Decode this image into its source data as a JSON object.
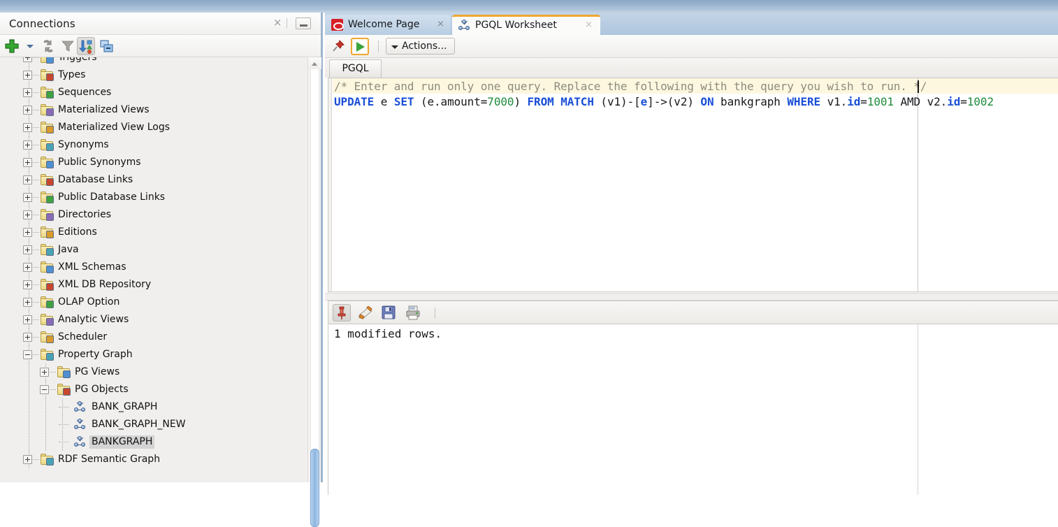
{
  "left_panel": {
    "title": "Connections",
    "close_label": "×",
    "toolbar": [
      {
        "name": "new-connection-icon",
        "label": "New Connection"
      },
      {
        "name": "new-connection-dropdown-icon",
        "label": "New Connection Options"
      },
      {
        "name": "refresh-icon",
        "label": "Refresh"
      },
      {
        "name": "filter-icon",
        "label": "Filter"
      },
      {
        "name": "sort-icon",
        "label": "Sort"
      },
      {
        "name": "collapse-all-icon",
        "label": "Collapse All"
      }
    ],
    "tree": [
      {
        "label": "Triggers",
        "level": 1,
        "state": "plus",
        "icon": "folder-triggers-icon"
      },
      {
        "label": "Types",
        "level": 1,
        "state": "plus",
        "icon": "folder-types-icon"
      },
      {
        "label": "Sequences",
        "level": 1,
        "state": "plus",
        "icon": "folder-sequences-icon"
      },
      {
        "label": "Materialized Views",
        "level": 1,
        "state": "plus",
        "icon": "folder-materialized-views-icon"
      },
      {
        "label": "Materialized View Logs",
        "level": 1,
        "state": "plus",
        "icon": "folder-materialized-view-logs-icon"
      },
      {
        "label": "Synonyms",
        "level": 1,
        "state": "plus",
        "icon": "folder-synonyms-icon"
      },
      {
        "label": "Public Synonyms",
        "level": 1,
        "state": "plus",
        "icon": "folder-public-synonyms-icon"
      },
      {
        "label": "Database Links",
        "level": 1,
        "state": "plus",
        "icon": "folder-database-links-icon"
      },
      {
        "label": "Public Database Links",
        "level": 1,
        "state": "plus",
        "icon": "folder-public-database-links-icon"
      },
      {
        "label": "Directories",
        "level": 1,
        "state": "plus",
        "icon": "folder-directories-icon"
      },
      {
        "label": "Editions",
        "level": 1,
        "state": "plus",
        "icon": "folder-editions-icon"
      },
      {
        "label": "Java",
        "level": 1,
        "state": "plus",
        "icon": "folder-java-icon"
      },
      {
        "label": "XML Schemas",
        "level": 1,
        "state": "plus",
        "icon": "folder-xml-schemas-icon"
      },
      {
        "label": "XML DB Repository",
        "level": 1,
        "state": "plus",
        "icon": "folder-xml-db-repository-icon"
      },
      {
        "label": "OLAP Option",
        "level": 1,
        "state": "plus",
        "icon": "folder-olap-option-icon"
      },
      {
        "label": "Analytic Views",
        "level": 1,
        "state": "plus",
        "icon": "folder-analytic-views-icon"
      },
      {
        "label": "Scheduler",
        "level": 1,
        "state": "plus",
        "icon": "folder-scheduler-icon"
      },
      {
        "label": "Property Graph",
        "level": 1,
        "state": "minus",
        "icon": "folder-property-graph-icon"
      },
      {
        "label": "PG Views",
        "level": 2,
        "state": "plus",
        "icon": "folder-pg-views-icon"
      },
      {
        "label": "PG Objects",
        "level": 2,
        "state": "minus",
        "icon": "folder-pg-objects-icon"
      },
      {
        "label": "BANK_GRAPH",
        "level": 3,
        "state": "leaf",
        "icon": "graph-icon"
      },
      {
        "label": "BANK_GRAPH_NEW",
        "level": 3,
        "state": "leaf",
        "icon": "graph-icon"
      },
      {
        "label": "BANKGRAPH",
        "level": 3,
        "state": "leaf",
        "icon": "graph-icon",
        "selected": true
      },
      {
        "label": "RDF Semantic Graph",
        "level": 1,
        "state": "plus",
        "icon": "folder-rdf-semantic-graph-icon"
      }
    ]
  },
  "editor_area": {
    "tabs": [
      {
        "label": "Welcome Page",
        "icon": "oracle-logo-icon",
        "active": false,
        "close": "×"
      },
      {
        "label": "PGQL Worksheet",
        "icon": "graph-icon",
        "active": true,
        "close": "×"
      }
    ],
    "toolbar": {
      "pin_label": "Pin",
      "run_label": "Run Query",
      "actions_label": "Actions..."
    },
    "sub_tab": "PGQL",
    "code": {
      "comment": "/* Enter and run only one query. Replace the following with the query you wish to run. */",
      "statement_tokens": [
        {
          "t": "UPDATE",
          "k": "kw"
        },
        {
          "t": " e ",
          "k": "plain"
        },
        {
          "t": "SET",
          "k": "kw"
        },
        {
          "t": " (e.amount=",
          "k": "plain"
        },
        {
          "t": "7000",
          "k": "num"
        },
        {
          "t": ") ",
          "k": "plain"
        },
        {
          "t": "FROM",
          "k": "kw"
        },
        {
          "t": " ",
          "k": "plain"
        },
        {
          "t": "MATCH",
          "k": "kw"
        },
        {
          "t": " (v1)-[",
          "k": "plain"
        },
        {
          "t": "e",
          "k": "kw2"
        },
        {
          "t": "]->(v2) ",
          "k": "plain"
        },
        {
          "t": "ON",
          "k": "kw"
        },
        {
          "t": " bankgraph ",
          "k": "plain"
        },
        {
          "t": "WHERE",
          "k": "kw"
        },
        {
          "t": " v1.",
          "k": "plain"
        },
        {
          "t": "id",
          "k": "kw2"
        },
        {
          "t": "=",
          "k": "plain"
        },
        {
          "t": "1001",
          "k": "num"
        },
        {
          "t": " AMD v2.",
          "k": "plain"
        },
        {
          "t": "id",
          "k": "kw2"
        },
        {
          "t": "=",
          "k": "plain"
        },
        {
          "t": "1002",
          "k": "num"
        }
      ]
    }
  },
  "results_panel": {
    "toolbar": [
      {
        "name": "pin-icon",
        "label": "Pin Results",
        "pressed": true
      },
      {
        "name": "eraser-icon",
        "label": "Clear"
      },
      {
        "name": "save-icon",
        "label": "Save"
      },
      {
        "name": "print-icon",
        "label": "Print"
      }
    ],
    "output": "1 modified rows."
  },
  "colors": {
    "accent_orange": "#f0a830",
    "keyword_blue": "#1a4fd6",
    "number_green": "#1f8a3b",
    "comment_gray": "#8e8c7d",
    "titlebar_blue": "#9db5cf",
    "selection_gray": "#d3d3d3"
  }
}
